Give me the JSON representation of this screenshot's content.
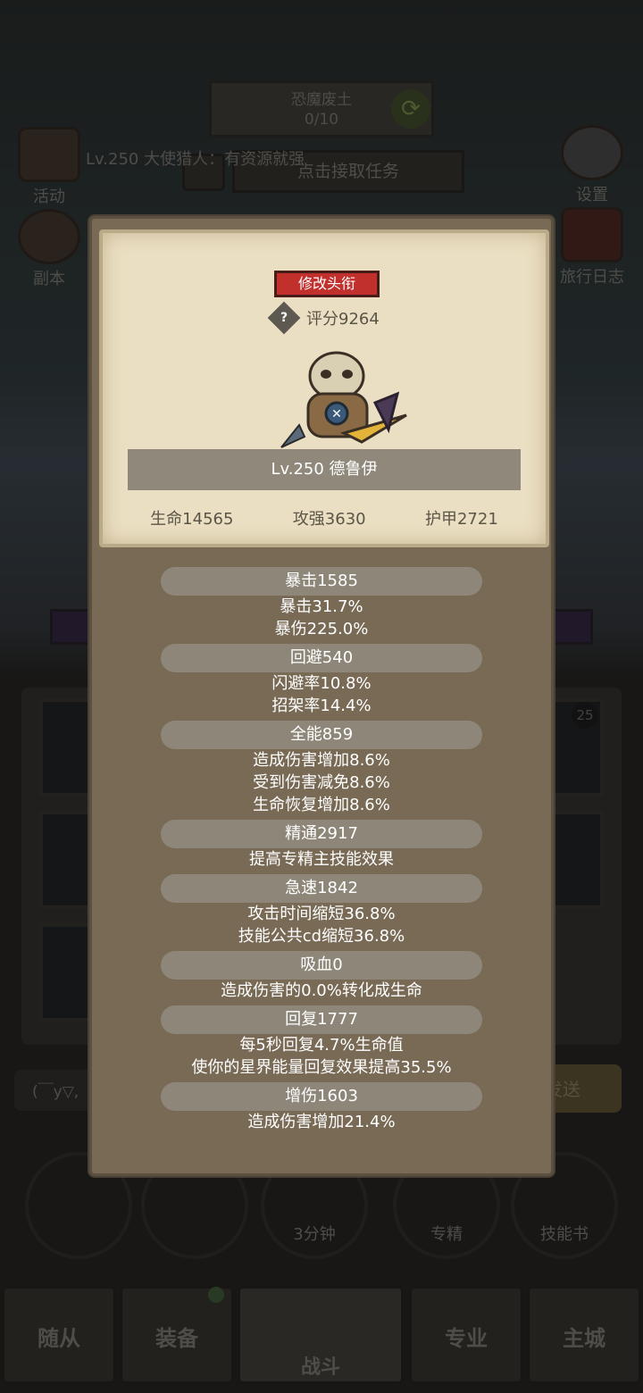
{
  "background": {
    "quest_title": "恐魔废土",
    "quest_progress": "0/10",
    "hunter_text": "Lv.250 大使猎人：有资源就强",
    "task_button": "点击接取任务",
    "left_buttons": [
      "活动",
      "副本"
    ],
    "right_buttons": [
      "设置",
      "旅行日志"
    ],
    "chat_text": "(￣y▽,",
    "send_label": "发送",
    "slot_badge": "25",
    "timer": "3分钟",
    "round_buttons": [
      "专精",
      "技能书"
    ],
    "tabs": [
      "随从",
      "装备",
      "战斗",
      "专业",
      "主城"
    ]
  },
  "popup": {
    "title_button": "修改头衔",
    "score": "评分9264",
    "help_icon": "?",
    "name": "Lv.250 德鲁伊",
    "base_stats": [
      "生命14565",
      "攻强3630",
      "护甲2721"
    ],
    "stats": [
      {
        "header": "暴击1585",
        "lines": [
          "暴击31.7%",
          "暴伤225.0%"
        ]
      },
      {
        "header": "回避540",
        "lines": [
          "闪避率10.8%",
          "招架率14.4%"
        ]
      },
      {
        "header": "全能859",
        "lines": [
          "造成伤害增加8.6%",
          "受到伤害减免8.6%",
          "生命恢复增加8.6%"
        ]
      },
      {
        "header": "精通2917",
        "lines": [
          "提高专精主技能效果"
        ]
      },
      {
        "header": "急速1842",
        "lines": [
          "攻击时间缩短36.8%",
          "技能公共cd缩短36.8%"
        ]
      },
      {
        "header": "吸血0",
        "lines": [
          "造成伤害的0.0%转化成生命"
        ]
      },
      {
        "header": "回复1777",
        "lines": [
          "每5秒回复4.7%生命值",
          "使你的星界能量回复效果提高35.5%"
        ]
      },
      {
        "header": "增伤1603",
        "lines": [
          "造成伤害增加21.4%"
        ]
      }
    ]
  }
}
